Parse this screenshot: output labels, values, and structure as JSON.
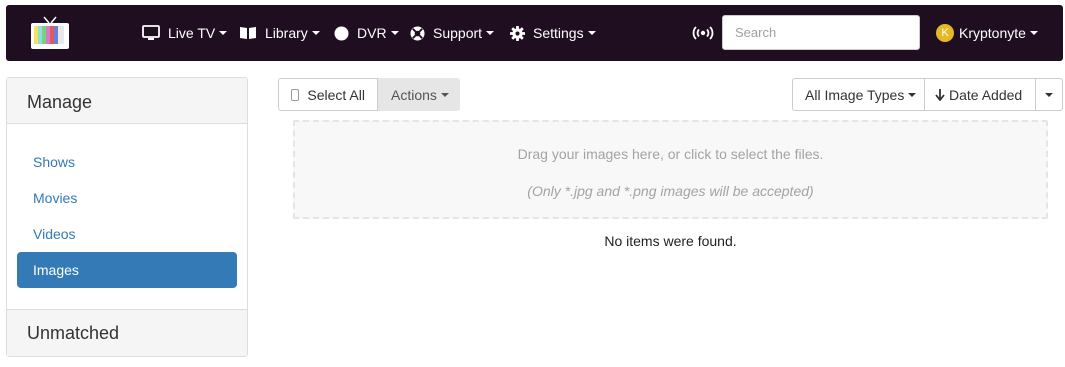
{
  "navbar": {
    "menus": [
      {
        "label": "Live TV",
        "icon": "tv-icon"
      },
      {
        "label": "Library",
        "icon": "book-icon"
      },
      {
        "label": "DVR",
        "icon": "circle-record-icon"
      },
      {
        "label": "Support",
        "icon": "lifebuoy-icon"
      },
      {
        "label": "Settings",
        "icon": "gear-icon"
      }
    ],
    "broadcast_icon": "broadcast-icon",
    "search_placeholder": "Search",
    "user": {
      "initial": "K",
      "name": "Kryptonyte"
    }
  },
  "sidebar": {
    "heading": "Manage",
    "items": [
      {
        "label": "Shows",
        "active": false
      },
      {
        "label": "Movies",
        "active": false
      },
      {
        "label": "Videos",
        "active": false
      },
      {
        "label": "Images",
        "active": true
      }
    ],
    "footer": "Unmatched"
  },
  "toolbar": {
    "select_all_label": "Select All",
    "actions_label": "Actions",
    "type_filter_label": "All Image Types",
    "sort_label": "Date Added"
  },
  "dropzone": {
    "line1": "Drag your images here, or click to select the files.",
    "line2": "(Only *.jpg and *.png images will be accepted)"
  },
  "empty_message": "No items were found.",
  "colors": {
    "navbar_bg": "#1f0e1f",
    "accent": "#337ab7",
    "avatar": "#e5b825"
  }
}
